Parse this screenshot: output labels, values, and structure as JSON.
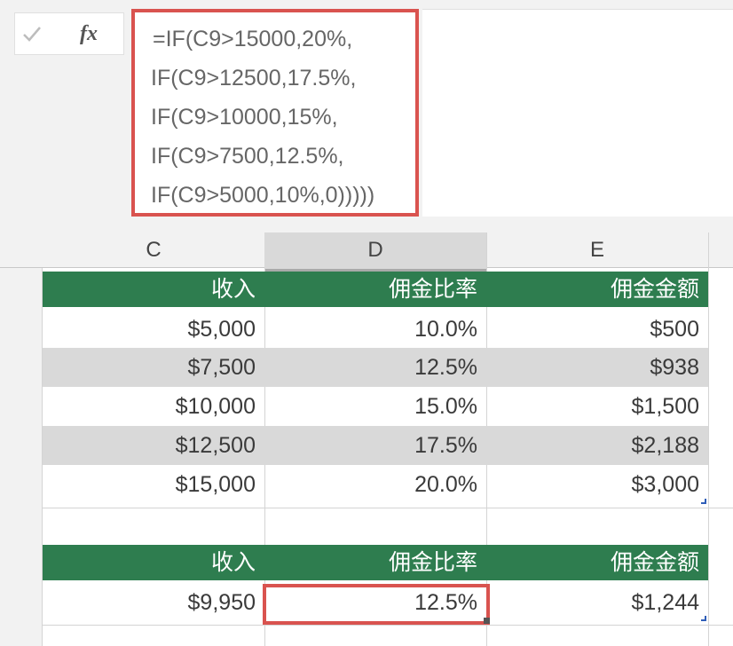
{
  "formula_bar": {
    "check_icon": "checkmark-icon",
    "fx_label": "fx",
    "lines": [
      "=IF(C9>15000,20%,",
      "IF(C9>12500,17.5%,",
      "IF(C9>10000,15%,",
      "IF(C9>7500,12.5%,",
      "IF(C9>5000,10%,0)))))"
    ],
    "highlight_color": "#d9534f"
  },
  "columns": [
    "C",
    "D",
    "E"
  ],
  "header_color": "#2e7d4f",
  "band_color": "#d9d9d9",
  "table1": {
    "headers": [
      "收入",
      "佣金比率",
      "佣金金额"
    ],
    "rows": [
      [
        "$5,000",
        "10.0%",
        "$500"
      ],
      [
        "$7,500",
        "12.5%",
        "$938"
      ],
      [
        "$10,000",
        "15.0%",
        "$1,500"
      ],
      [
        "$12,500",
        "17.5%",
        "$2,188"
      ],
      [
        "$15,000",
        "20.0%",
        "$3,000"
      ]
    ]
  },
  "table2": {
    "headers": [
      "收入",
      "佣金比率",
      "佣金金额"
    ],
    "row": [
      "$9,950",
      "12.5%",
      "$1,244"
    ]
  }
}
